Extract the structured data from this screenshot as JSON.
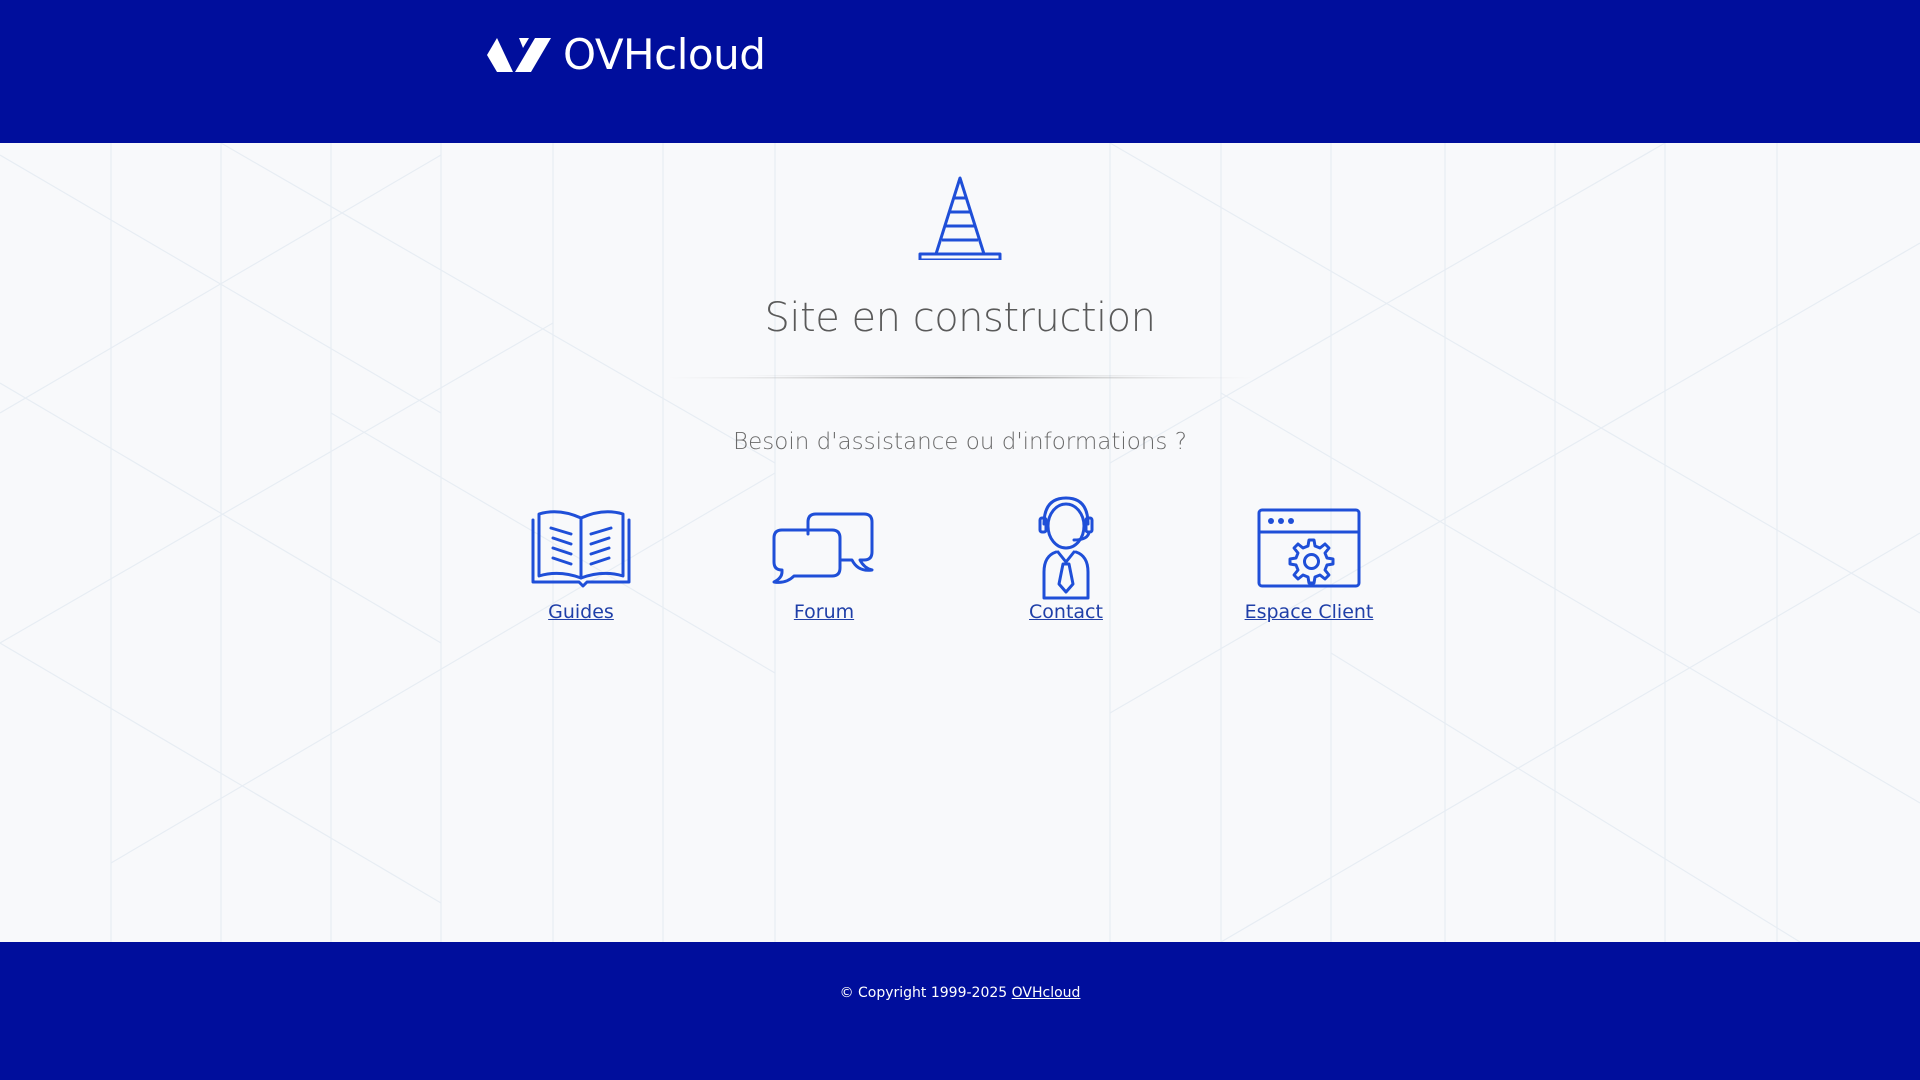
{
  "header": {
    "brand": "OVHcloud",
    "background_color": "#000e9c"
  },
  "main": {
    "hero_icon": "traffic-cone-icon",
    "title": "Site en construction",
    "subtitle": "Besoin d'assistance ou d'informations ?",
    "accent_color": "#1f4fd8",
    "links": [
      {
        "label": "Guides",
        "icon": "open-book-icon"
      },
      {
        "label": "Forum",
        "icon": "chat-bubbles-icon"
      },
      {
        "label": "Contact",
        "icon": "support-agent-icon"
      },
      {
        "label": "Espace Client",
        "icon": "browser-settings-icon"
      }
    ]
  },
  "footer": {
    "copyright": "© Copyright 1999-2025",
    "link_label": "OVHcloud"
  }
}
